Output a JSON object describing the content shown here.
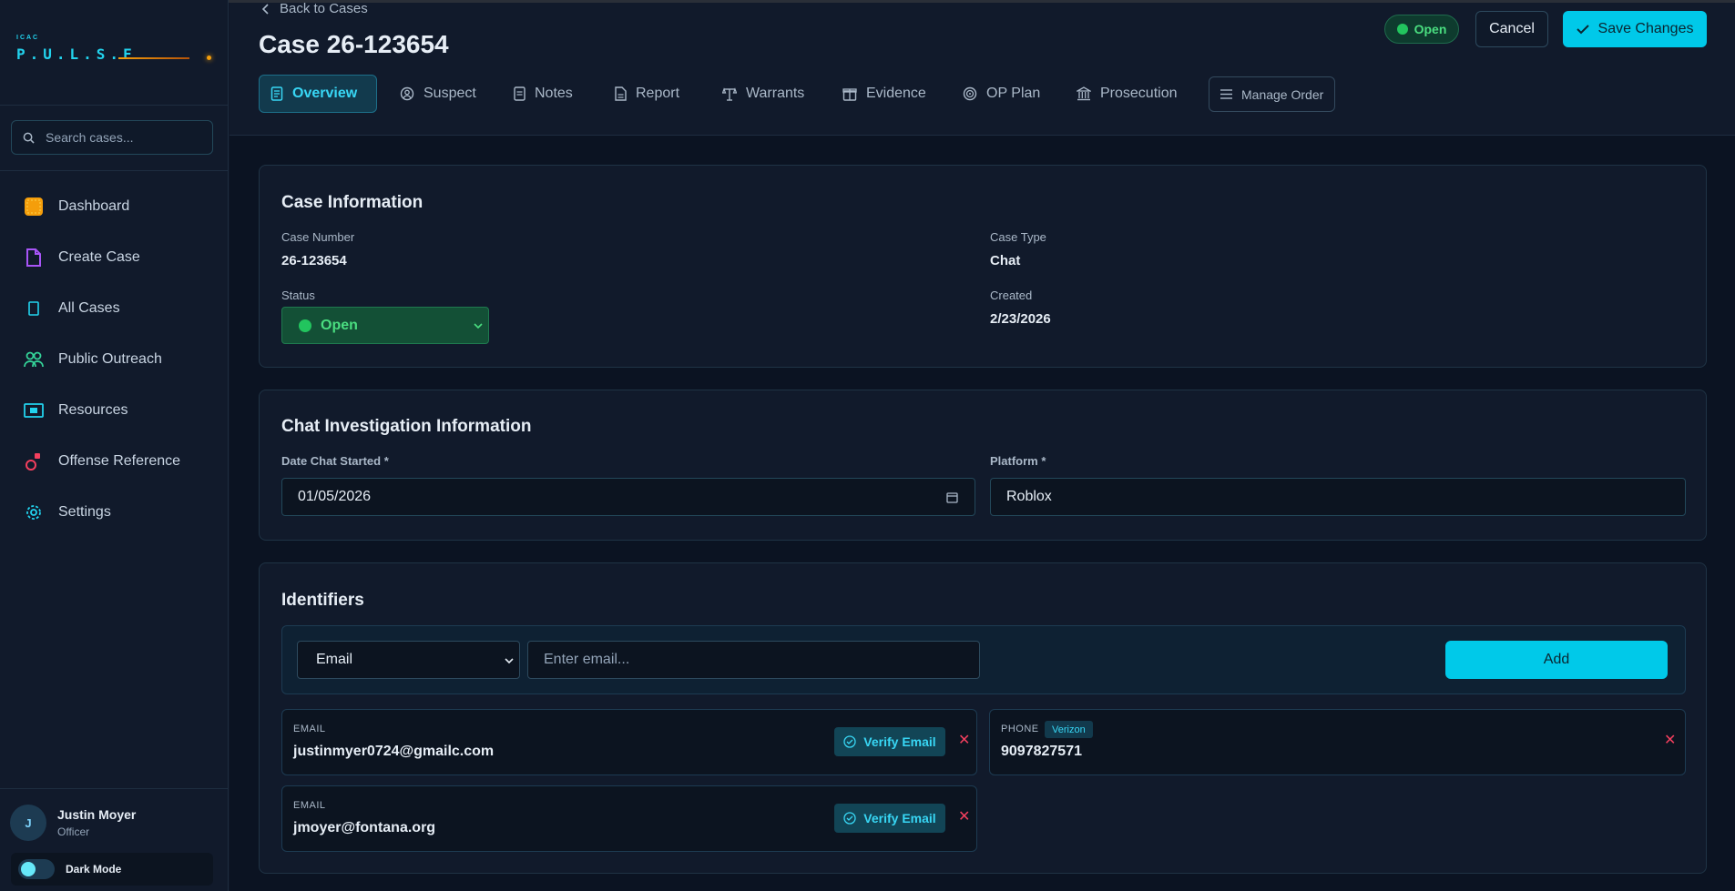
{
  "app": {
    "logo_small": "ICAC",
    "logo_big": "P.U.L.S.E"
  },
  "sidebar": {
    "search_placeholder": "Search cases...",
    "items": [
      {
        "label": "Dashboard",
        "icon": "dashboard-icon",
        "color": "#f59e0b"
      },
      {
        "label": "Create Case",
        "icon": "file-plus-icon",
        "color": "#a855f7"
      },
      {
        "label": "All Cases",
        "icon": "folder-icon",
        "color": "#22d3ee"
      },
      {
        "label": "Public Outreach",
        "icon": "users-icon",
        "color": "#34d399"
      },
      {
        "label": "Resources",
        "icon": "resources-icon",
        "color": "#22d3ee"
      },
      {
        "label": "Offense Reference",
        "icon": "scale-icon",
        "color": "#f43f5e"
      },
      {
        "label": "Settings",
        "icon": "gear-icon",
        "color": "#22d3ee"
      }
    ],
    "user": {
      "initial": "J",
      "name": "Justin Moyer",
      "role": "Officer"
    },
    "dark_mode_label": "Dark Mode"
  },
  "header": {
    "back_label": "Back to Cases",
    "title": "Case 26-123654",
    "status_label": "Open",
    "cancel_label": "Cancel",
    "save_label": "Save Changes",
    "tabs": [
      {
        "label": "Overview",
        "icon": "document-icon",
        "active": true
      },
      {
        "label": "Suspect",
        "icon": "suspect-icon",
        "active": false
      },
      {
        "label": "Notes",
        "icon": "notes-icon",
        "active": false
      },
      {
        "label": "Report",
        "icon": "report-icon",
        "active": false
      },
      {
        "label": "Warrants",
        "icon": "warrant-icon",
        "active": false
      },
      {
        "label": "Evidence",
        "icon": "evidence-icon",
        "active": false
      },
      {
        "label": "OP Plan",
        "icon": "target-icon",
        "active": false
      },
      {
        "label": "Prosecution",
        "icon": "courthouse-icon",
        "active": false
      }
    ],
    "manage_order_label": "Manage Order"
  },
  "case_info": {
    "title": "Case Information",
    "case_number_label": "Case Number",
    "case_number": "26-123654",
    "case_type_label": "Case Type",
    "case_type": "Chat",
    "status_label": "Status",
    "status_value": "Open",
    "created_label": "Created",
    "created": "2/23/2026"
  },
  "chat_info": {
    "title": "Chat Investigation Information",
    "date_label": "Date Chat Started *",
    "date_value": "01/05/2026",
    "platform_label": "Platform *",
    "platform_value": "Roblox"
  },
  "identifiers": {
    "title": "Identifiers",
    "type_selected": "Email",
    "input_placeholder": "Enter email...",
    "add_label": "Add",
    "verify_label": "Verify Email",
    "items": [
      {
        "type": "EMAIL",
        "value": "justinmyer0724@gmailc.com"
      },
      {
        "type": "PHONE",
        "carrier": "Verizon",
        "value": "9097827571"
      },
      {
        "type": "EMAIL",
        "value": "jmoyer@fontana.org"
      }
    ]
  },
  "colors": {
    "accent": "#00c9e9",
    "success": "#22c55e",
    "danger": "#f43f5e",
    "background": "#0b1322"
  }
}
